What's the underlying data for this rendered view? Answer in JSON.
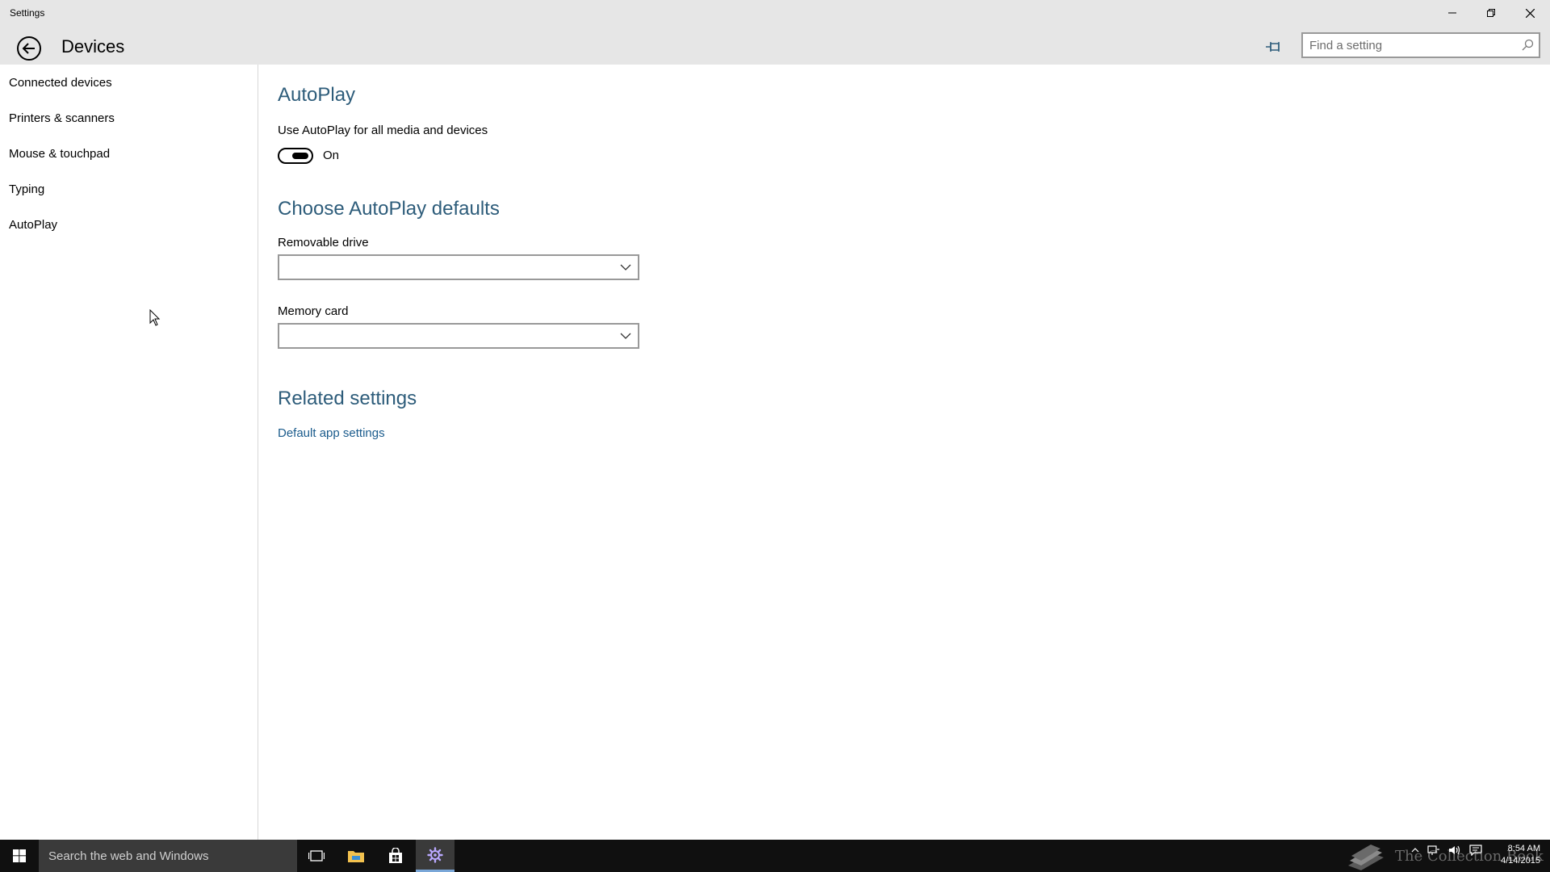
{
  "window": {
    "title": "Settings"
  },
  "header": {
    "title": "Devices",
    "search_placeholder": "Find a setting"
  },
  "sidebar": {
    "items": [
      {
        "label": "Connected devices"
      },
      {
        "label": "Printers & scanners"
      },
      {
        "label": "Mouse & touchpad"
      },
      {
        "label": "Typing"
      },
      {
        "label": "AutoPlay"
      }
    ]
  },
  "main": {
    "autoplay_heading": "AutoPlay",
    "autoplay_toggle_label": "Use AutoPlay for all media and devices",
    "autoplay_toggle_state": "On",
    "defaults_heading": "Choose AutoPlay defaults",
    "removable_drive_label": "Removable drive",
    "removable_drive_value": "",
    "memory_card_label": "Memory card",
    "memory_card_value": "",
    "related_heading": "Related settings",
    "related_link": "Default app settings"
  },
  "taskbar": {
    "search_placeholder": "Search the web and Windows",
    "watermark": "The Collection Book",
    "time": "8:54 AM",
    "date": "4/14/2015"
  },
  "colors": {
    "heading": "#2d5c7a",
    "link": "#1a5b8c",
    "chrome": "#e6e6e6",
    "taskbar": "#101010"
  },
  "icons": {
    "back": "back-arrow-icon",
    "pin": "pin-icon",
    "search": "search-icon",
    "minimize": "minimize-icon",
    "restore": "restore-icon",
    "close": "close-icon",
    "chevron": "chevron-down-icon",
    "start": "windows-logo-icon",
    "task_view": "task-view-icon",
    "explorer": "file-explorer-icon",
    "store": "store-icon",
    "settings": "gear-icon"
  }
}
